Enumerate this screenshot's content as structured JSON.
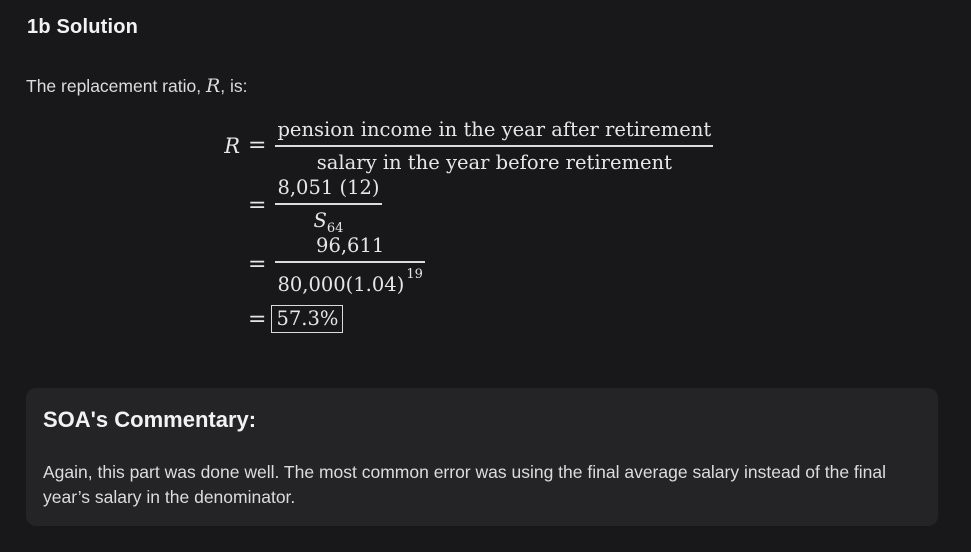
{
  "section": {
    "title": "1b Solution"
  },
  "intro": {
    "text_before": "The replacement ratio, ",
    "variable": "R",
    "text_after": ", is:"
  },
  "equation": {
    "lhs_variable": "R",
    "equals": "=",
    "step1": {
      "numerator": "pension income in the year after retirement",
      "denominator": "salary in the year before retirement"
    },
    "step2": {
      "numerator": "8,051 (12)",
      "denominator_symbol": "S",
      "denominator_subscript": "64"
    },
    "step3": {
      "numerator": "96,611",
      "denominator_base": "80,000(1.04)",
      "denominator_exponent": "19"
    },
    "result": "57.3%"
  },
  "commentary": {
    "title": "SOA's Commentary:",
    "body": "Again, this part was done well. The most common error was using the final average salary instead of the final year’s salary in the denominator."
  }
}
